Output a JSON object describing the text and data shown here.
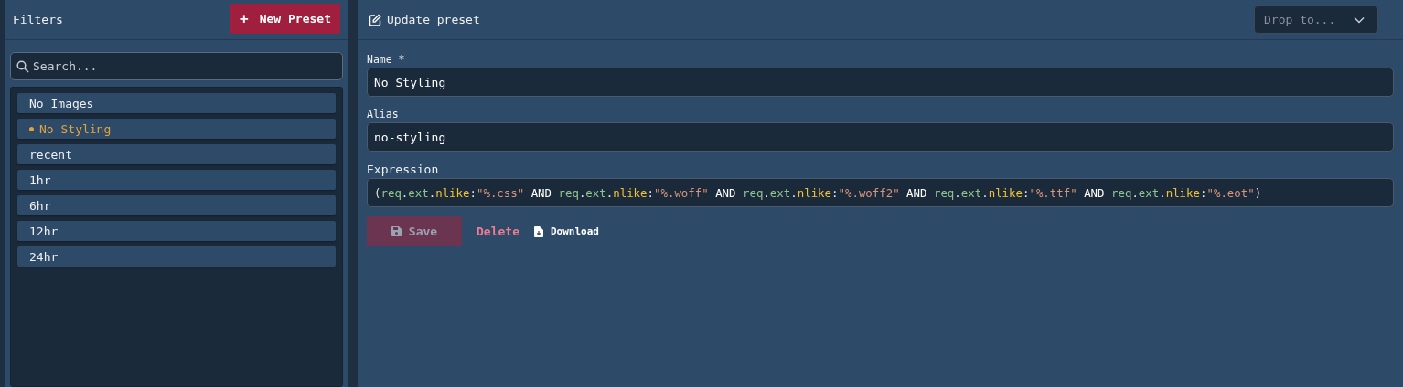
{
  "sidebar": {
    "title": "Filters",
    "new_button": {
      "label": "New Preset",
      "icon": "+"
    },
    "search": {
      "placeholder": "Search..."
    },
    "items": [
      {
        "label": "No Images",
        "selected": false
      },
      {
        "label": "No Styling",
        "selected": true
      },
      {
        "label": "recent",
        "selected": false
      },
      {
        "label": "1hr",
        "selected": false
      },
      {
        "label": "6hr",
        "selected": false
      },
      {
        "label": "12hr",
        "selected": false
      },
      {
        "label": "24hr",
        "selected": false
      }
    ]
  },
  "editor": {
    "title": "Update preset",
    "drop": {
      "placeholder": "Drop to..."
    },
    "fields": [
      {
        "label": "Name *",
        "value": "No Styling",
        "kind": "input"
      },
      {
        "label": "Alias",
        "value": "no-styling",
        "kind": "input"
      }
    ],
    "expression": {
      "label": "Expression",
      "tokens": [
        {
          "text": "(",
          "kind": "punct"
        },
        {
          "text": "req",
          "kind": "field"
        },
        {
          "text": ".",
          "kind": "punct"
        },
        {
          "text": "ext",
          "kind": "field"
        },
        {
          "text": ".",
          "kind": "punct"
        },
        {
          "text": "nlike",
          "kind": "op"
        },
        {
          "text": ":",
          "kind": "punct"
        },
        {
          "text": "\"%.css\"",
          "kind": "string"
        },
        {
          "text": " AND ",
          "kind": "keyword"
        },
        {
          "text": "req",
          "kind": "field"
        },
        {
          "text": ".",
          "kind": "punct"
        },
        {
          "text": "ext",
          "kind": "field"
        },
        {
          "text": ".",
          "kind": "punct"
        },
        {
          "text": "nlike",
          "kind": "op"
        },
        {
          "text": ":",
          "kind": "punct"
        },
        {
          "text": "\"%.woff\"",
          "kind": "string"
        },
        {
          "text": " AND ",
          "kind": "keyword"
        },
        {
          "text": "req",
          "kind": "field"
        },
        {
          "text": ".",
          "kind": "punct"
        },
        {
          "text": "ext",
          "kind": "field"
        },
        {
          "text": ".",
          "kind": "punct"
        },
        {
          "text": "nlike",
          "kind": "op"
        },
        {
          "text": ":",
          "kind": "punct"
        },
        {
          "text": "\"%.woff2\"",
          "kind": "string"
        },
        {
          "text": " AND ",
          "kind": "keyword"
        },
        {
          "text": "req",
          "kind": "field"
        },
        {
          "text": ".",
          "kind": "punct"
        },
        {
          "text": "ext",
          "kind": "field"
        },
        {
          "text": ".",
          "kind": "punct"
        },
        {
          "text": "nlike",
          "kind": "op"
        },
        {
          "text": ":",
          "kind": "punct"
        },
        {
          "text": "\"%.ttf\"",
          "kind": "string"
        },
        {
          "text": " AND ",
          "kind": "keyword"
        },
        {
          "text": "req",
          "kind": "field"
        },
        {
          "text": ".",
          "kind": "punct"
        },
        {
          "text": "ext",
          "kind": "field"
        },
        {
          "text": ".",
          "kind": "punct"
        },
        {
          "text": "nlike",
          "kind": "op"
        },
        {
          "text": ":",
          "kind": "punct"
        },
        {
          "text": "\"%.eot\"",
          "kind": "string"
        },
        {
          "text": ")",
          "kind": "punct"
        }
      ]
    },
    "actions": [
      {
        "label": "Save",
        "kind": "save",
        "disabled": true
      },
      {
        "label": "Delete",
        "kind": "delete",
        "disabled": false
      },
      {
        "label": "Download",
        "kind": "download",
        "disabled": false
      }
    ]
  }
}
